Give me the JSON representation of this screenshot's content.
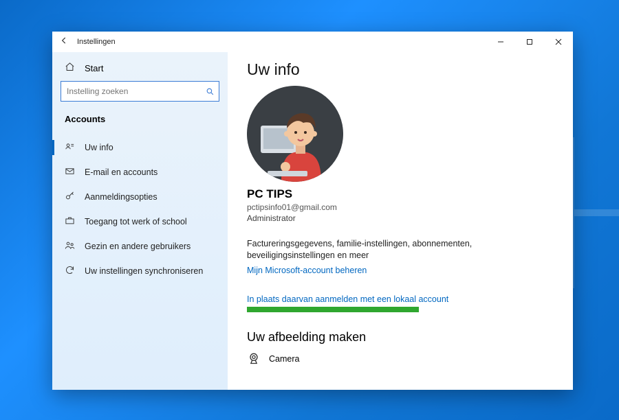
{
  "window": {
    "title": "Instellingen"
  },
  "sidebar": {
    "home": "Start",
    "search_placeholder": "Instelling zoeken",
    "section": "Accounts",
    "items": [
      {
        "label": "Uw info"
      },
      {
        "label": "E-mail en accounts"
      },
      {
        "label": "Aanmeldingsopties"
      },
      {
        "label": "Toegang tot werk of school"
      },
      {
        "label": "Gezin en andere gebruikers"
      },
      {
        "label": "Uw instellingen synchroniseren"
      }
    ]
  },
  "main": {
    "heading": "Uw info",
    "display_name": "PC TIPS",
    "email": "pctipsinfo01@gmail.com",
    "role": "Administrator",
    "billing_blurb": "Factureringsgegevens, familie-instellingen, abonnementen, beveiligingsinstellingen en meer",
    "manage_link": "Mijn Microsoft-account beheren",
    "local_account_link": "In plaats daarvan aanmelden met een lokaal account",
    "picture_heading": "Uw afbeelding maken",
    "camera_label": "Camera"
  }
}
